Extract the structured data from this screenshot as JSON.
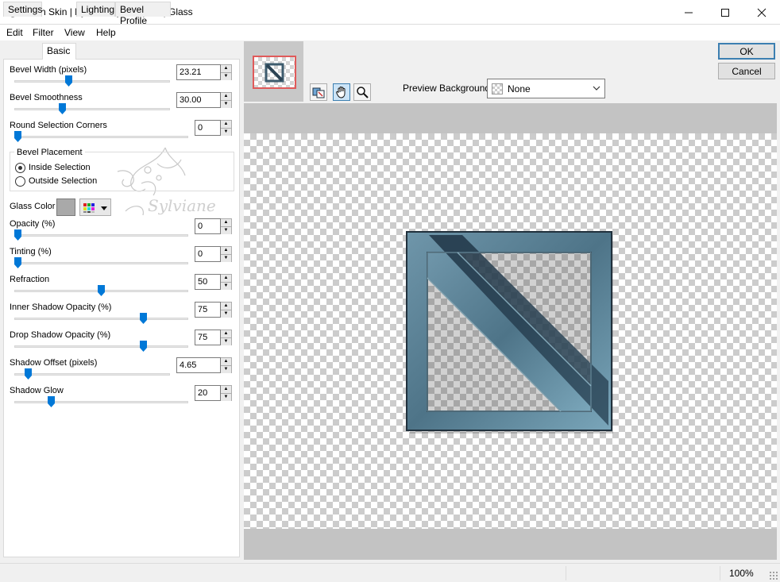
{
  "window": {
    "title": "Alien Skin | Eye Candy 5 Impact | Glass",
    "minimize_icon": "minimize-icon",
    "maximize_icon": "maximize-icon",
    "close_icon": "close-icon"
  },
  "menu": [
    "Edit",
    "Filter",
    "View",
    "Help"
  ],
  "tabs": [
    "Settings",
    "Basic",
    "Lighting",
    "Bevel Profile"
  ],
  "active_tab": "Basic",
  "controls": {
    "bevel_width": {
      "label": "Bevel Width (pixels)",
      "value": "23.21",
      "level": 0.34
    },
    "bevel_smoothness": {
      "label": "Bevel Smoothness",
      "value": "30.00",
      "level": 0.3
    },
    "round_corners": {
      "label": "Round Selection Corners",
      "value": "0",
      "level": 0.0
    },
    "bevel_placement": {
      "title": "Bevel Placement",
      "inside": "Inside Selection",
      "outside": "Outside Selection",
      "selected": "Inside Selection"
    },
    "glass_color": {
      "label": "Glass Color",
      "color": "#a9a9a9"
    },
    "opacity": {
      "label": "Opacity (%)",
      "value": "0",
      "level": 0.0
    },
    "tinting": {
      "label": "Tinting (%)",
      "value": "0",
      "level": 0.0
    },
    "refraction": {
      "label": "Refraction",
      "value": "50",
      "level": 0.5
    },
    "inner_shadow_opacity": {
      "label": "Inner Shadow Opacity (%)",
      "value": "75",
      "level": 0.75
    },
    "drop_shadow_opacity": {
      "label": "Drop Shadow Opacity (%)",
      "value": "75",
      "level": 0.75
    },
    "shadow_offset": {
      "label": "Shadow Offset (pixels)",
      "value": "4.65",
      "level": 0.07
    },
    "shadow_glow": {
      "label": "Shadow Glow",
      "value": "20",
      "level": 0.2
    }
  },
  "watermark_text": "Sylviane",
  "buttons": {
    "ok": "OK",
    "cancel": "Cancel"
  },
  "preview": {
    "background_label": "Preview Background:",
    "background_value": "None",
    "tools": [
      "preview-toggle-icon",
      "hand-icon",
      "zoom-icon"
    ]
  },
  "status": {
    "zoom": "100%"
  },
  "colors": {
    "accent": "#0078d7",
    "artwork": "#4e7488",
    "thumb_border": "#e05a5a"
  }
}
